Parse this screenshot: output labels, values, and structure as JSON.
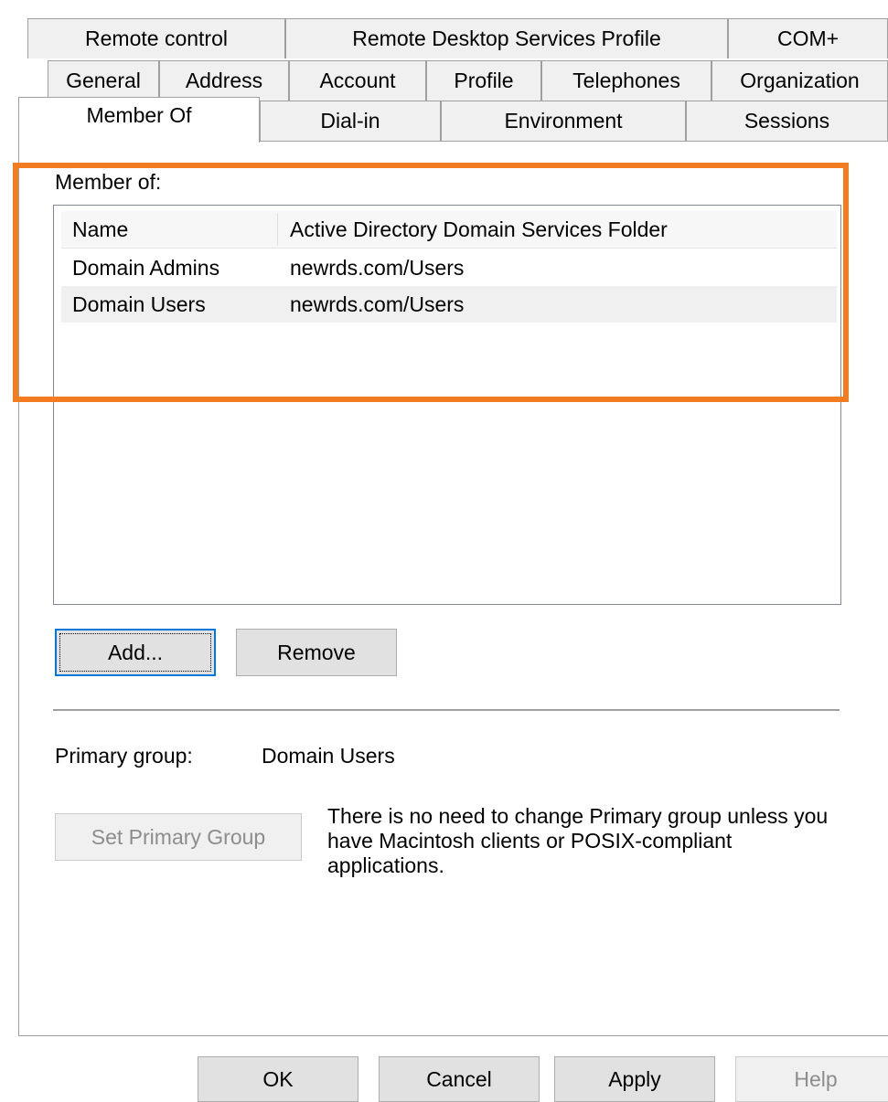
{
  "tabs": {
    "row1": [
      "Remote control",
      "Remote Desktop Services Profile",
      "COM+"
    ],
    "row2": [
      "General",
      "Address",
      "Account",
      "Profile",
      "Telephones",
      "Organization"
    ],
    "row3": [
      "Member Of",
      "Dial-in",
      "Environment",
      "Sessions"
    ],
    "active": "Member Of"
  },
  "member_of": {
    "label": "Member of:",
    "columns": [
      "Name",
      "Active Directory Domain Services Folder"
    ],
    "rows": [
      {
        "name": "Domain Admins",
        "folder": "newrds.com/Users"
      },
      {
        "name": "Domain Users",
        "folder": "newrds.com/Users"
      }
    ]
  },
  "buttons": {
    "add": "Add...",
    "remove": "Remove",
    "set_primary": "Set Primary Group"
  },
  "primary_group": {
    "label": "Primary group:",
    "value": "Domain Users",
    "note": "There is no need to change Primary group unless you have Macintosh clients or POSIX-compliant applications."
  },
  "footer": {
    "ok": "OK",
    "cancel": "Cancel",
    "apply": "Apply",
    "help": "Help"
  },
  "colors": {
    "highlight": "#f47c20",
    "focus": "#0078d7"
  }
}
